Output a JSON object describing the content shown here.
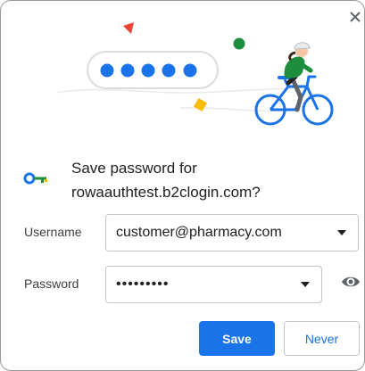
{
  "dialog": {
    "title": "Save password for rowaauthtest.b2clogin.com?",
    "close_icon": "close-icon",
    "key_icon": "key-icon",
    "illustration": "cyclist-password-illustration"
  },
  "username": {
    "label": "Username",
    "value": "customer@pharmacy.com"
  },
  "password": {
    "label": "Password",
    "value": "•••••••••",
    "reveal_icon": "eye-icon"
  },
  "actions": {
    "save_label": "Save",
    "never_label": "Never"
  },
  "colors": {
    "accent": "#1a73e8",
    "green": "#1e8e3e",
    "yellow": "#fbbc04",
    "red": "#ea4335"
  }
}
